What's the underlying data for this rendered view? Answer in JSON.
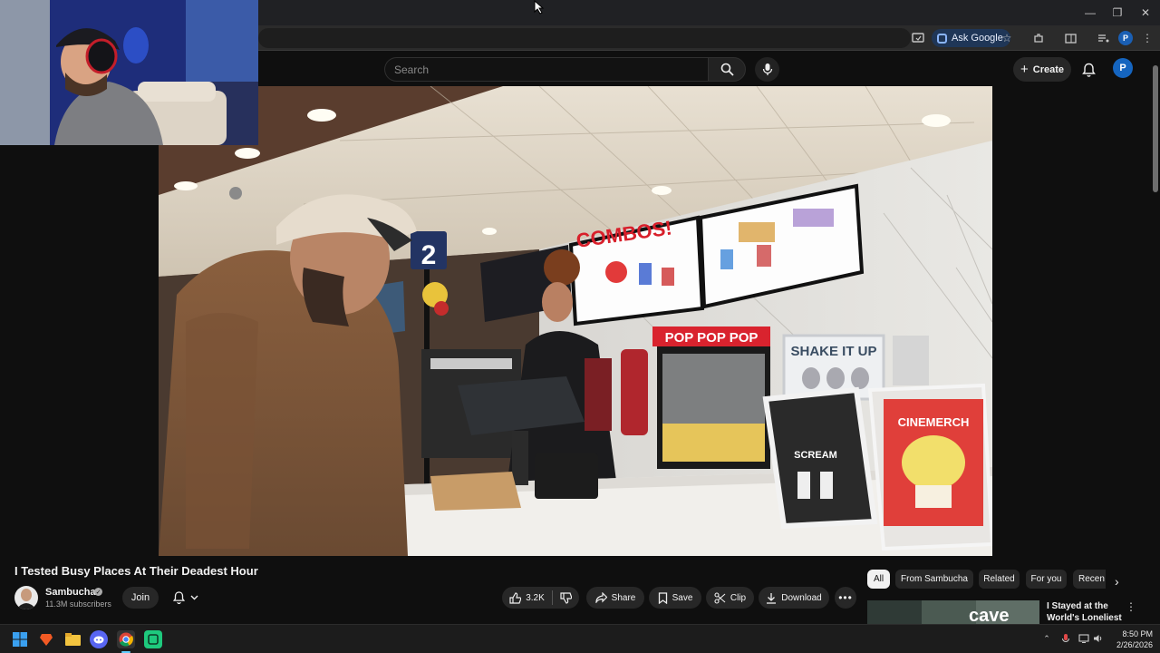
{
  "browser": {
    "ask_google_label": "Ask Google",
    "profile_initial": "P",
    "window_controls": [
      "minimize",
      "restore",
      "close"
    ]
  },
  "masthead": {
    "search_placeholder": "Search",
    "create_label": "Create",
    "avatar_initial": "P"
  },
  "video": {
    "title": "I Tested Busy Places At Their Deadest Hour",
    "signage": {
      "combos": "COMBOS!",
      "popcorn": "POP POP POP",
      "shake": "SHAKE IT UP",
      "register_number": "2",
      "cinemerch": "CINEMERCH",
      "scream": "SCREAM"
    }
  },
  "channel": {
    "name": "Sambucha",
    "subscribers": "11.3M subscribers",
    "join_label": "Join"
  },
  "actions": {
    "likes": "3.2K",
    "share": "Share",
    "save": "Save",
    "clip": "Clip",
    "download": "Download"
  },
  "chips": [
    "All",
    "From Sambucha",
    "Related",
    "For you",
    "Recen"
  ],
  "recommendation": {
    "thumb_text": "cave",
    "title": "I Stayed at the World's Loneliest ..."
  },
  "taskbar": {
    "time": "8:50 PM",
    "date": "2/26/2026"
  },
  "colors": {
    "background": "#0f0f0f",
    "accent_blue": "#1565c0",
    "popcorn_red": "#d9232e"
  }
}
